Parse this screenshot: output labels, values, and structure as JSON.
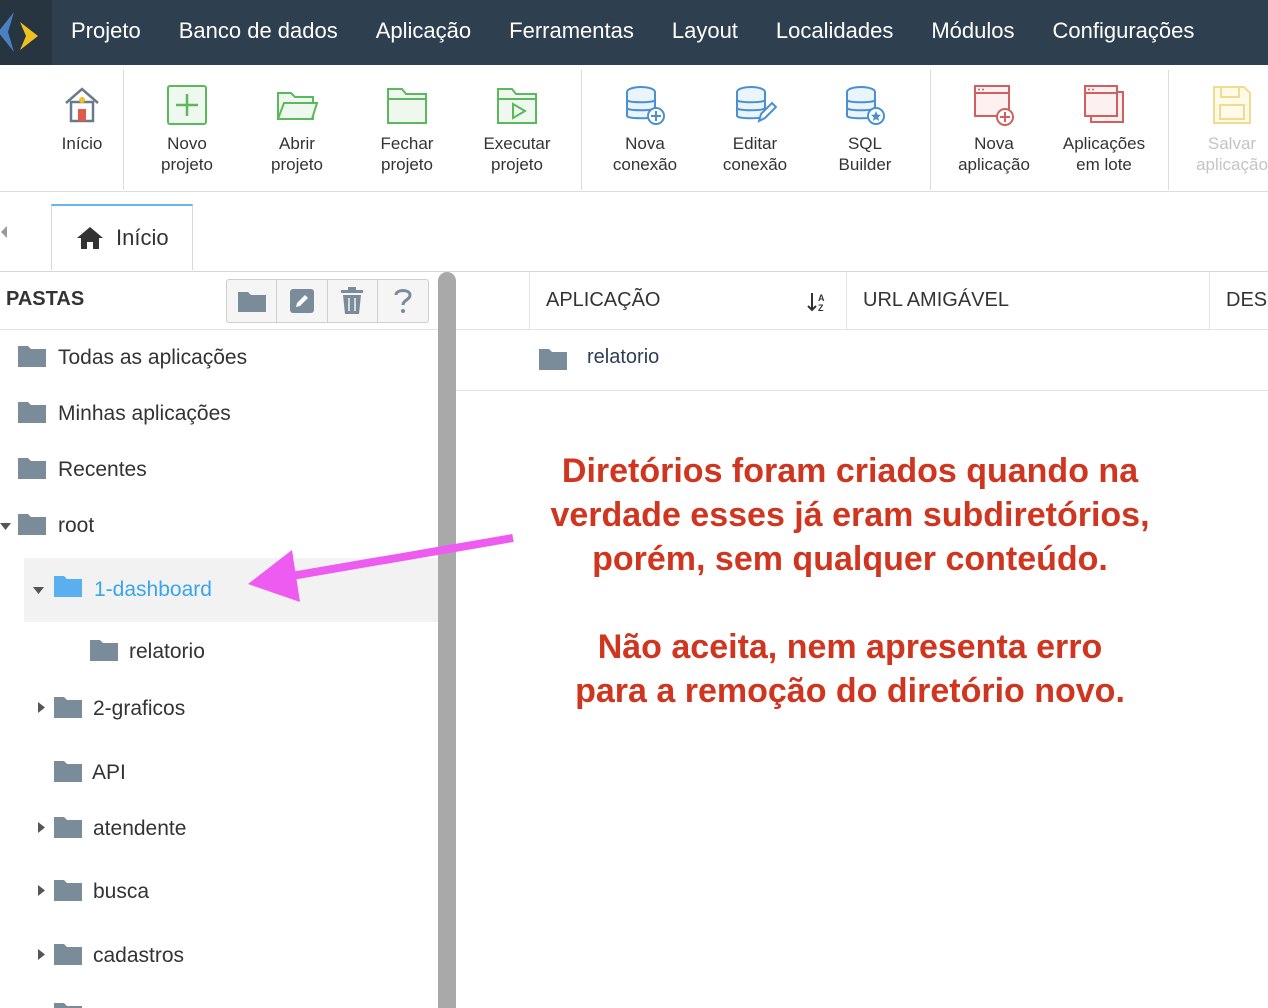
{
  "menubar": {
    "items": [
      "Projeto",
      "Banco de dados",
      "Aplicação",
      "Ferramentas",
      "Layout",
      "Localidades",
      "Módulos",
      "Configurações"
    ]
  },
  "toolbar": {
    "buttons": [
      {
        "label": "Início",
        "icon": "home-icon"
      },
      {
        "label": "Novo\nprojeto",
        "icon": "new-project-icon"
      },
      {
        "label": "Abrir\nprojeto",
        "icon": "open-folder-icon"
      },
      {
        "label": "Fechar\nprojeto",
        "icon": "close-folder-icon"
      },
      {
        "label": "Executar\nprojeto",
        "icon": "run-project-icon"
      },
      {
        "label": "Nova\nconexão",
        "icon": "new-connection-icon"
      },
      {
        "label": "Editar\nconexão",
        "icon": "edit-connection-icon"
      },
      {
        "label": "SQL\nBuilder",
        "icon": "sql-builder-icon"
      },
      {
        "label": "Nova\naplicação",
        "icon": "new-application-icon"
      },
      {
        "label": "Aplicações\nem lote",
        "icon": "batch-applications-icon"
      },
      {
        "label": "Salvar\naplicação",
        "icon": "save-application-icon"
      }
    ]
  },
  "tabs": [
    {
      "label": "Início",
      "icon": "home-icon"
    }
  ],
  "left_panel": {
    "title": "PASTAS",
    "actions": [
      "folder-icon",
      "edit-icon",
      "trash-icon",
      "help-icon"
    ],
    "tree": [
      {
        "label": "Todas as aplicações"
      },
      {
        "label": "Minhas aplicações"
      },
      {
        "label": "Recentes"
      },
      {
        "label": "root"
      },
      {
        "label": "1-dashboard"
      },
      {
        "label": "relatorio"
      },
      {
        "label": "2-graficos"
      },
      {
        "label": "API"
      },
      {
        "label": "atendente"
      },
      {
        "label": "busca"
      },
      {
        "label": "cadastros"
      }
    ]
  },
  "table": {
    "columns": [
      "APLICAÇÃO",
      "URL AMIGÁVEL",
      "DES"
    ],
    "rows": [
      {
        "name": "relatorio"
      }
    ]
  },
  "annotation": {
    "color": "#d0361f",
    "arrow_color": "#ee5bf0",
    "line1": "Diretórios foram criados quando na",
    "line2": "verdade esses já eram subdiretórios,",
    "line3": "porém, sem qualquer conteúdo.",
    "line4": "Não aceita, nem apresenta erro",
    "line5": "para a remoção do diretório novo."
  },
  "colors": {
    "menubar": "#2e3f50",
    "selected_text": "#39a5ec",
    "folder": "#7a8b99",
    "folder_selected": "#5ab0ee"
  }
}
